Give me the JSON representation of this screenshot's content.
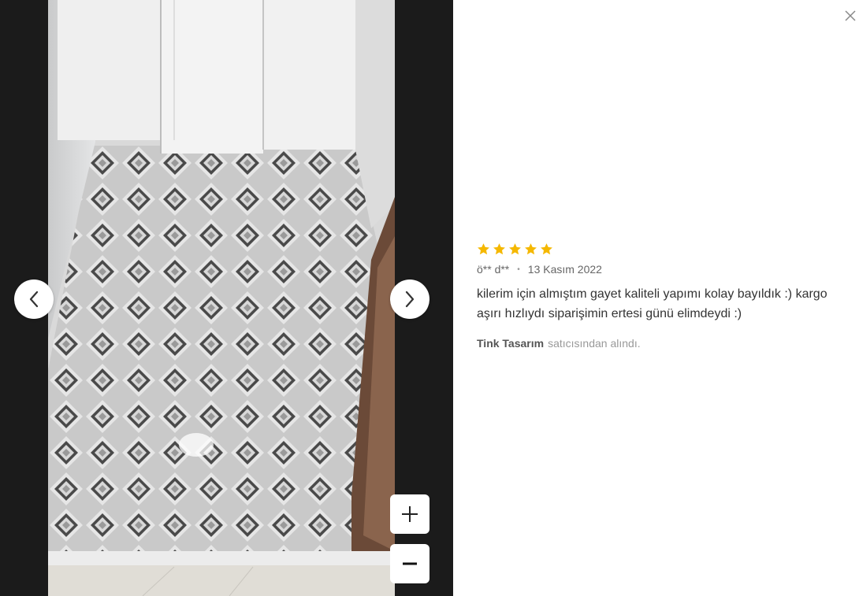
{
  "review": {
    "rating": 5,
    "rating_max": 5,
    "author": "ö** d**",
    "separator": "•",
    "date": "13 Kasım 2022",
    "comment": "kilerim için almıştım gayet kaliteli yapımı kolay bayıldık :) kargo aşırı hızlıydı siparişimin ertesi günü elimdeydi :)",
    "seller_name": "Tink Tasarım",
    "seller_suffix": "satıcısından alındı."
  },
  "icons": {
    "prev": "chevron-left-icon",
    "next": "chevron-right-icon",
    "zoom_in": "plus-icon",
    "zoom_out": "minus-icon",
    "close": "close-icon",
    "star": "star-icon"
  },
  "colors": {
    "viewer_bg": "#1b1b1b",
    "star": "#f5b800",
    "text": "#333333",
    "muted": "#999999"
  }
}
